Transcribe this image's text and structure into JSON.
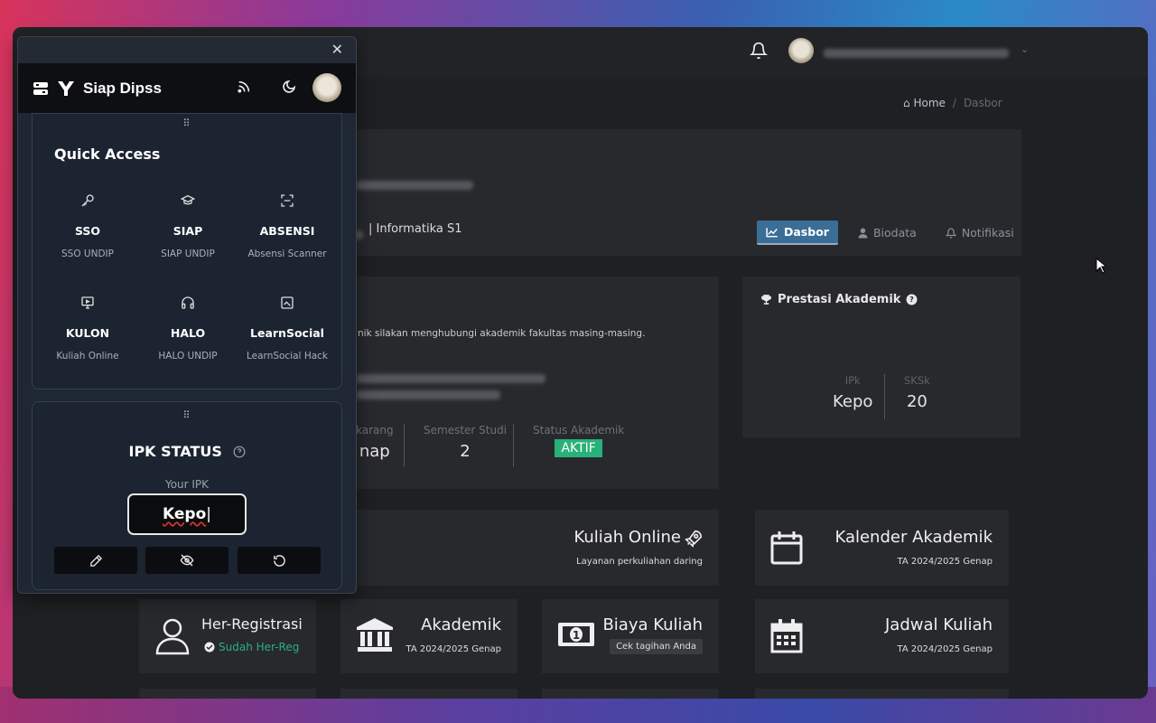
{
  "site": {
    "breadcrumb": {
      "home": "Home",
      "current": "Dasbor"
    },
    "profile": {
      "major": "| Informatika S1",
      "tabs": [
        {
          "label": "Dasbor",
          "active": true
        },
        {
          "label": "Biodata",
          "active": false
        },
        {
          "label": "Notifikasi",
          "active": false
        }
      ]
    },
    "info": {
      "text": "nik silakan menghubungi akademik fakultas masing-masing.",
      "stats": [
        {
          "label": "karang",
          "value": "nap"
        },
        {
          "label": "Semester Studi",
          "value": "2"
        },
        {
          "label": "Status Akademik",
          "value": "AKTIF"
        }
      ]
    },
    "prestasi": {
      "title": "Prestasi Akademik",
      "ipk_label": "IPk",
      "ipk_value": "Kepo",
      "sks_label": "SKSk",
      "sks_value": "20"
    },
    "cards": {
      "kuliah_online": {
        "title": "Kuliah Online",
        "sub": "Layanan perkuliahan daring"
      },
      "kalender": {
        "title": "Kalender Akademik",
        "sub": "TA 2024/2025 Genap"
      },
      "her_reg": {
        "title": "Her-Registrasi",
        "sub": "Sudah Her-Reg"
      },
      "akademik": {
        "title": "Akademik",
        "sub": "TA 2024/2025 Genap"
      },
      "biaya": {
        "title": "Biaya Kuliah",
        "sub": "Cek tagihan Anda"
      },
      "jadwal": {
        "title": "Jadwal Kuliah",
        "sub": "TA 2024/2025 Genap"
      }
    },
    "colors": {
      "accent": "#3b6e96",
      "success": "#29b17a"
    }
  },
  "extension": {
    "brand": "Siap Dipss",
    "quick_access": {
      "title": "Quick Access",
      "items": [
        {
          "name": "SSO",
          "sub": "SSO UNDIP",
          "icon": "key-icon"
        },
        {
          "name": "SIAP",
          "sub": "SIAP UNDIP",
          "icon": "graduation-cap-icon"
        },
        {
          "name": "ABSENSI",
          "sub": "Absensi Scanner",
          "icon": "scan-icon"
        },
        {
          "name": "KULON",
          "sub": "Kuliah Online",
          "icon": "monitor-icon"
        },
        {
          "name": "HALO",
          "sub": "HALO UNDIP",
          "icon": "headphones-icon"
        },
        {
          "name": "LearnSocial",
          "sub": "LearnSocial Hack",
          "icon": "image-icon"
        }
      ]
    },
    "ipk": {
      "title": "IPK STATUS",
      "label": "Your IPK",
      "value": "Kepo"
    }
  }
}
